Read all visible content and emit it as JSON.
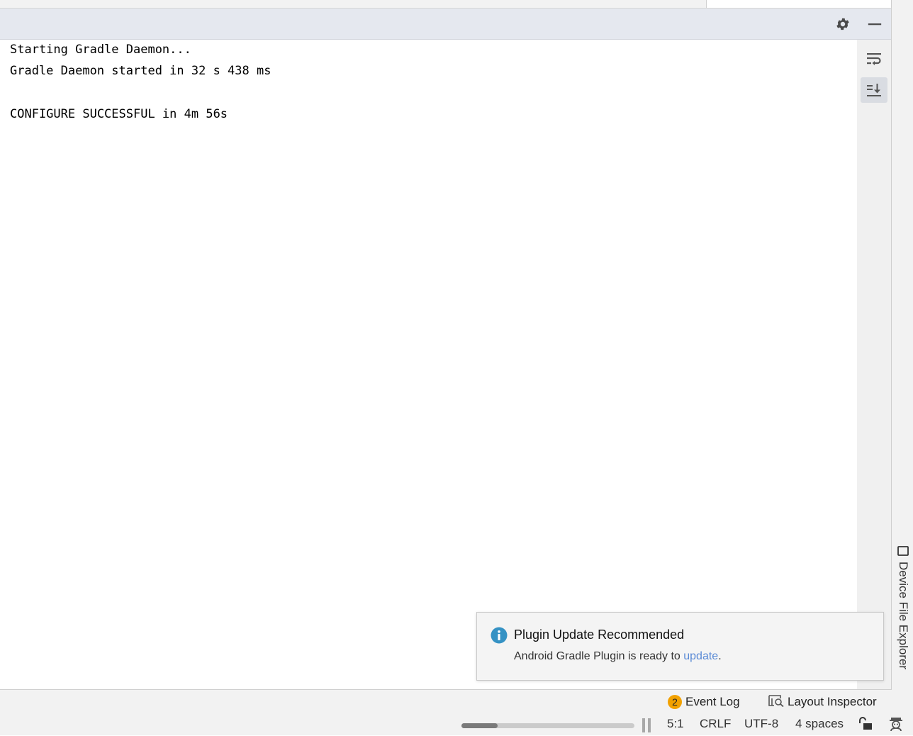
{
  "console": {
    "lines": [
      "Starting Gradle Daemon...",
      "Gradle Daemon started in 32 s 438 ms",
      "",
      "CONFIGURE SUCCESSFUL in 4m 56s"
    ]
  },
  "tool_header": {
    "settings_icon": "gear-icon",
    "minimize_icon": "minimize-icon"
  },
  "side_toolbar": {
    "soft_wrap_icon": "soft-wrap-icon",
    "scroll_to_end_icon": "scroll-to-end-icon"
  },
  "right_strip": {
    "device_file_explorer": "Device File Explorer"
  },
  "notification": {
    "title": "Plugin Update Recommended",
    "body_prefix": "Android Gradle Plugin is ready to ",
    "link": "update",
    "body_suffix": "."
  },
  "bottom_bar": {
    "event_log_count": "2",
    "event_log_label": "Event Log",
    "layout_inspector_label": "Layout Inspector"
  },
  "status_bar": {
    "progress_fraction": 0.21,
    "position": "5:1",
    "line_separator": "CRLF",
    "encoding": "UTF-8",
    "indent": "4 spaces"
  },
  "colors": {
    "header_bg": "#e5e8ef",
    "badge": "#f2a100",
    "info_icon": "#3592c4",
    "link": "#5b8bd6"
  }
}
